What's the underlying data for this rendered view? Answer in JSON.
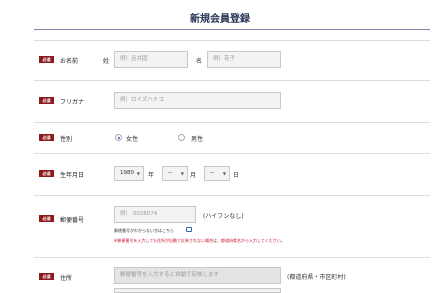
{
  "page": {
    "title": "新規会員登録"
  },
  "required_badge": "必須",
  "fields": {
    "name": {
      "label": "お名前",
      "last_prefix": "姓",
      "last_placeholder": "例）呂井固",
      "first_prefix": "名",
      "first_placeholder": "例）花子"
    },
    "kana": {
      "label": "フリガナ",
      "placeholder": "例）ロイズハナコ"
    },
    "gender": {
      "label": "性別",
      "options": [
        "女性",
        "男性"
      ],
      "selected": "女性"
    },
    "birthday": {
      "label": "生年月日",
      "year": "1980",
      "year_unit": "年",
      "month": "--",
      "month_unit": "月",
      "day": "--",
      "day_unit": "日"
    },
    "postal": {
      "label": "郵便番号",
      "placeholder": "例） 0028074",
      "suffix": "(ハイフンなし)",
      "help_text": "郵便番号がわからない方はこちら",
      "warning": "※郵便番号を入力しても住所が自動で反映されない場合は、都道府県名から入力してください。"
    },
    "address": {
      "label": "住所",
      "placeholder": "郵便番号を入力すると自動で反映します",
      "suffix": "(都道府県・市区町村)"
    }
  },
  "colors": {
    "badge": "#8c1a1a",
    "title": "#2a3658",
    "warning": "#c8102e"
  }
}
